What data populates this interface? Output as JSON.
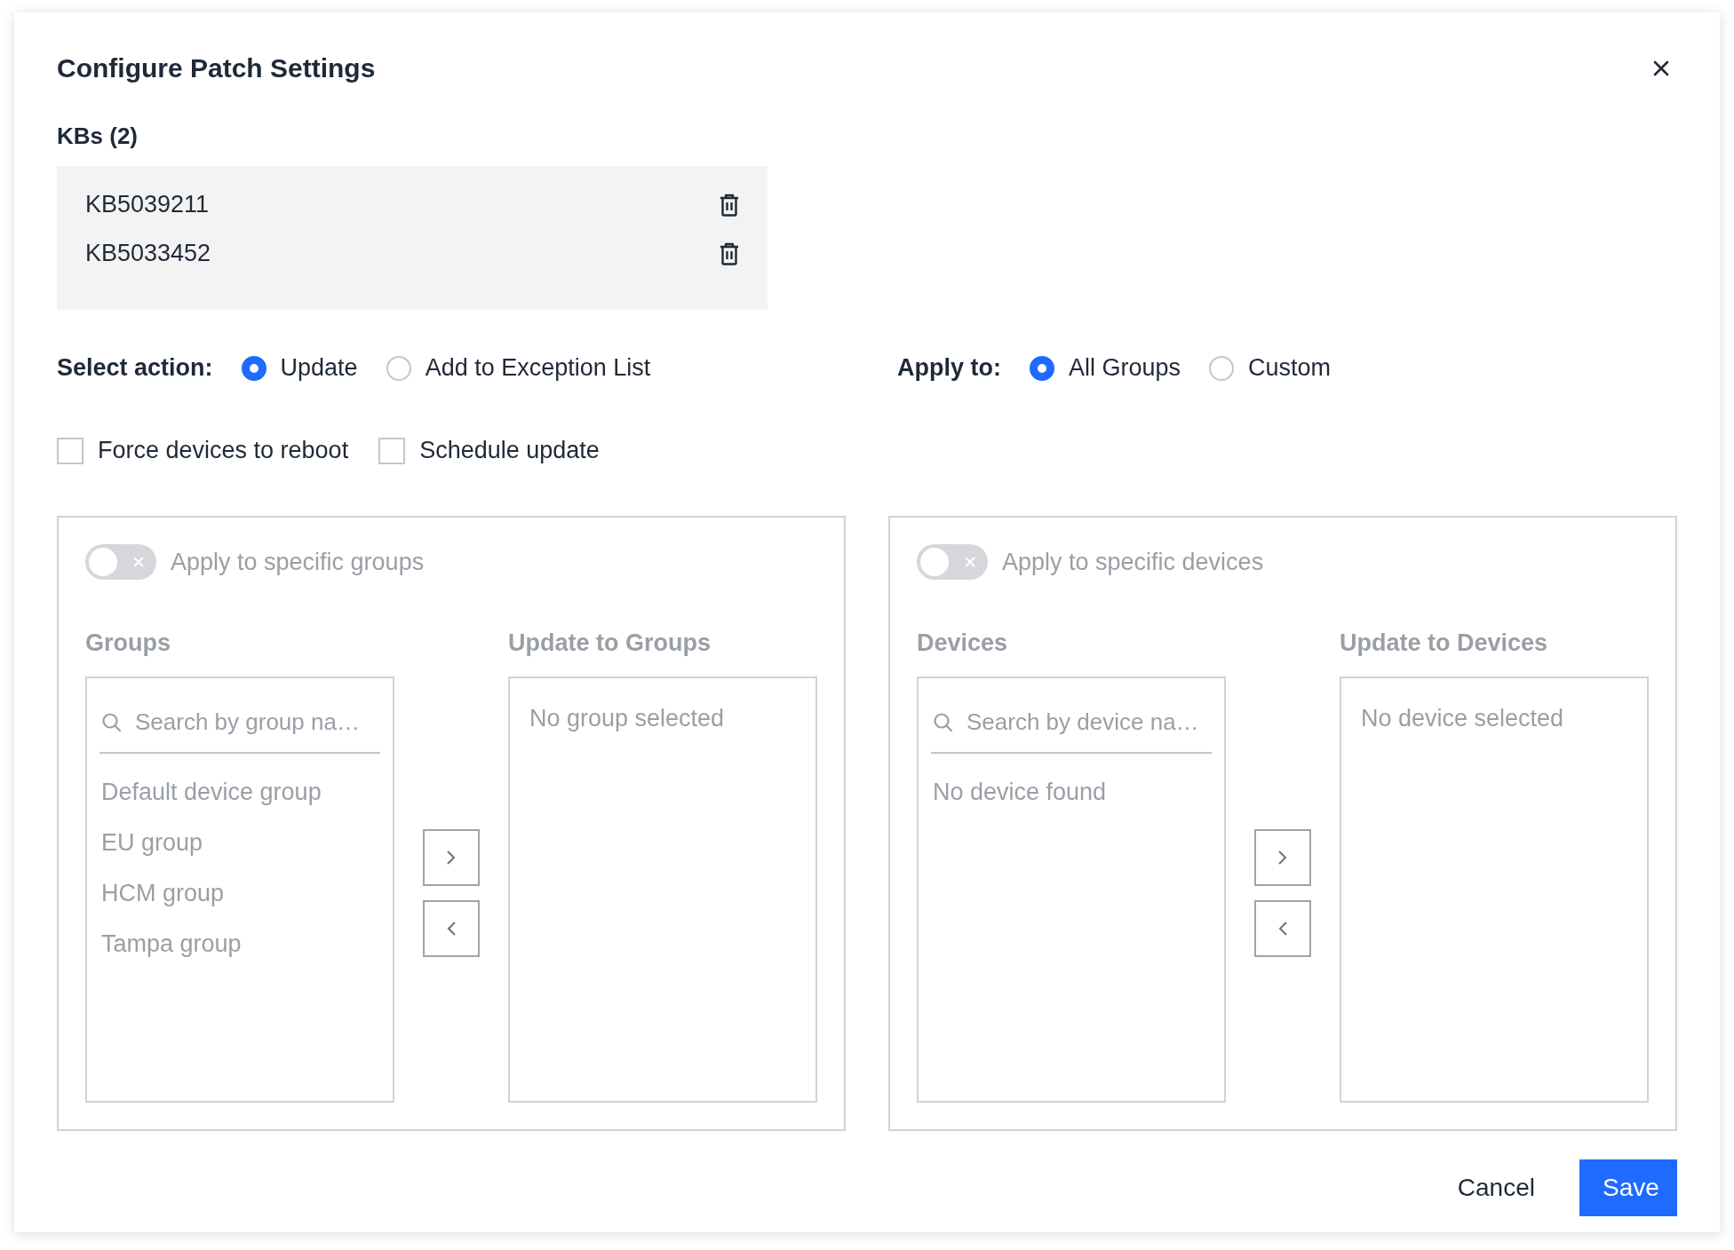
{
  "dialog": {
    "title": "Configure Patch Settings"
  },
  "kbs": {
    "label": "KBs (2)",
    "items": [
      {
        "id": "KB5039211"
      },
      {
        "id": "KB5033452"
      }
    ]
  },
  "select_action": {
    "label": "Select action:",
    "options": [
      {
        "label": "Update",
        "selected": true
      },
      {
        "label": "Add to Exception List",
        "selected": false
      }
    ]
  },
  "apply_to": {
    "label": "Apply to:",
    "options": [
      {
        "label": "All Groups",
        "selected": true
      },
      {
        "label": "Custom",
        "selected": false
      }
    ]
  },
  "checkboxes": [
    {
      "label": "Force devices to reboot",
      "checked": false
    },
    {
      "label": "Schedule update",
      "checked": false
    }
  ],
  "panels": [
    {
      "disabled": true,
      "toggle": {
        "label": "Apply to specific groups",
        "on": false
      },
      "source": {
        "title": "Groups",
        "search": {
          "placeholder": "Search by group na…"
        },
        "items": [
          "Default device group",
          "EU group",
          "HCM group",
          "Tampa group"
        ]
      },
      "target": {
        "title": "Update to Groups",
        "empty": "No group selected"
      }
    },
    {
      "disabled": true,
      "toggle": {
        "label": "Apply to specific devices",
        "on": false
      },
      "source": {
        "title": "Devices",
        "search": {
          "placeholder": "Search by device na…"
        },
        "empty": "No device found"
      },
      "target": {
        "title": "Update to Devices",
        "empty": "No device selected"
      }
    }
  ],
  "buttons": [
    {
      "label": "Cancel",
      "kind": "secondary"
    },
    {
      "label": "Save",
      "kind": "primary"
    }
  ]
}
